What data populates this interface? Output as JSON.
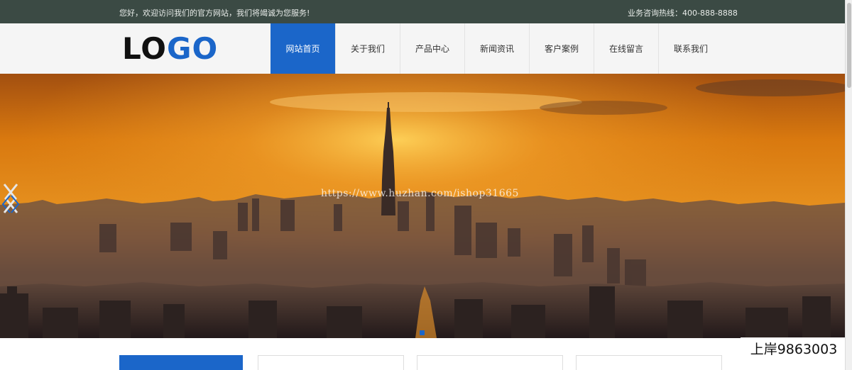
{
  "topbar": {
    "welcome": "您好，欢迎访问我们的官方网站，我们将竭诚为您服务!",
    "hotline": "业务咨询热线：400-888-8888"
  },
  "header": {
    "logo_part1": "LO",
    "logo_part2": "GO"
  },
  "nav": {
    "items": [
      {
        "label": "网站首页",
        "active": true
      },
      {
        "label": "关于我们"
      },
      {
        "label": "产品中心"
      },
      {
        "label": "新闻资讯"
      },
      {
        "label": "客户案例"
      },
      {
        "label": "在线留言"
      },
      {
        "label": "联系我们"
      }
    ]
  },
  "banner": {
    "watermark_url": "https://www.huzhan.com/ishop31665",
    "arrow_left_icon": "chevron-left-icon",
    "arrow_right_icon": "chevron-right-icon"
  },
  "overlay": {
    "watermark_id": "上岸9863003"
  },
  "colors": {
    "accent": "#1b66c9",
    "topbar": "#3b4a44",
    "header_bg": "#f5f5f5"
  }
}
